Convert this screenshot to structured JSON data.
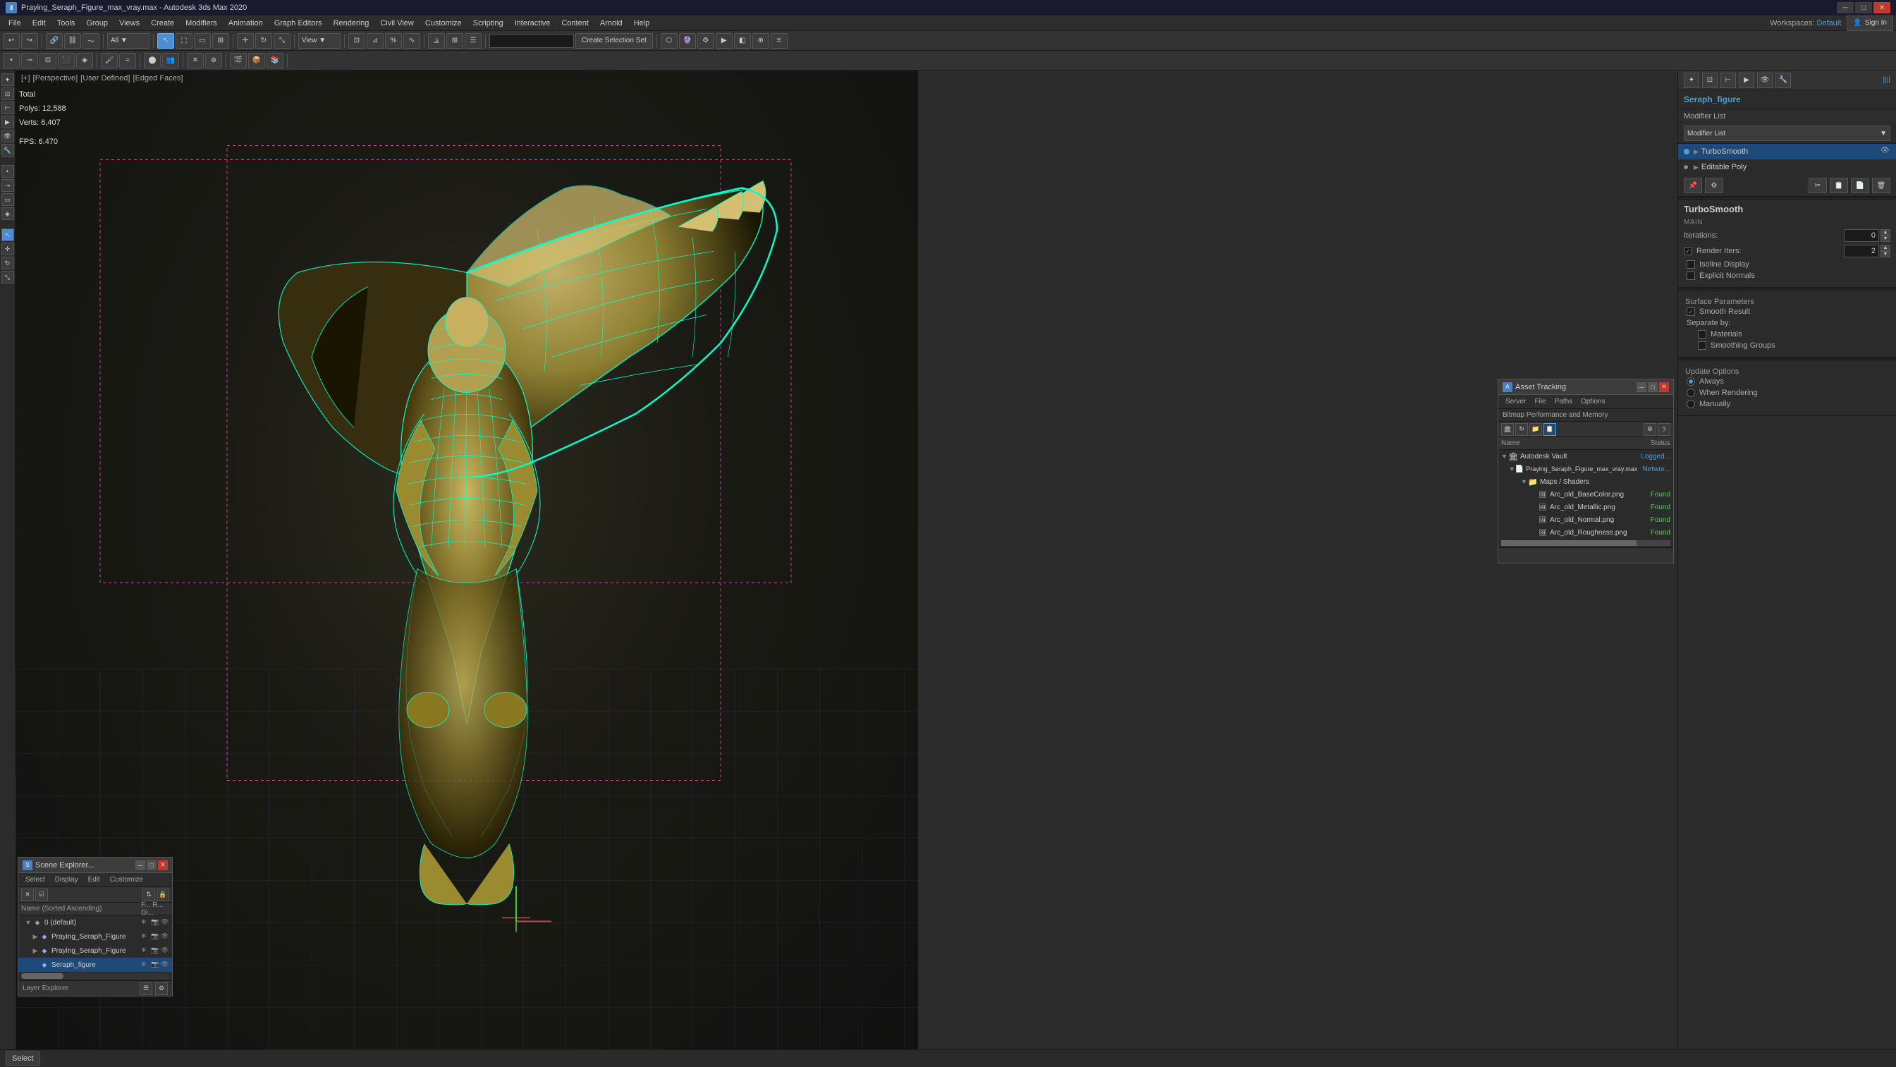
{
  "window": {
    "title": "Praying_Seraph_Figure_max_vray.max - Autodesk 3ds Max 2020",
    "icon": "3dsmax"
  },
  "menu": {
    "items": [
      "File",
      "Edit",
      "Tools",
      "Group",
      "Views",
      "Create",
      "Modifiers",
      "Animation",
      "Graph Editors",
      "Rendering",
      "Civil View",
      "Customize",
      "Scripting",
      "Interactive",
      "Content",
      "Arnold",
      "Help"
    ]
  },
  "workspaces": {
    "label": "Workspaces:",
    "value": "Default"
  },
  "signin": {
    "label": "Sign In",
    "icon": "user-icon"
  },
  "toolbar": {
    "create_selection_set": "Create Selection Set",
    "undo_icon": "↩",
    "redo_icon": "↪"
  },
  "viewport": {
    "label": "[+] [Perspective] [User Defined] [Edged Faces]",
    "nav_parts": [
      "[+]",
      "[Perspective]",
      "[User Defined]",
      "[Edged Faces]"
    ],
    "stats": {
      "total_label": "Total",
      "polys_label": "Polys:",
      "polys_value": "12,588",
      "verts_label": "Verts:",
      "verts_value": "6,407",
      "fps_label": "FPS:",
      "fps_value": "6.470"
    }
  },
  "right_panel": {
    "object_name": "Seraph_figure",
    "modifier_list_label": "Modifier List",
    "modifiers": [
      {
        "name": "TurboSmooth",
        "selected": true
      },
      {
        "name": "Editable Poly",
        "selected": false
      }
    ],
    "mod_buttons": [
      "pin",
      "configure",
      "remove",
      "cut"
    ],
    "turbosmooth": {
      "title": "TurboSmooth",
      "section_main": "Main",
      "iterations_label": "Iterations:",
      "iterations_value": "0",
      "render_iters_label": "Render Iters:",
      "render_iters_value": "2",
      "render_iters_checked": true,
      "isoline_display_label": "Isoline Display",
      "isoline_display_checked": false,
      "explicit_normals_label": "Explicit Normals",
      "explicit_normals_checked": false,
      "surface_parameters_label": "Surface Parameters",
      "smooth_result_label": "Smooth Result",
      "smooth_result_checked": true,
      "separate_by_label": "Separate by:",
      "materials_label": "Materials",
      "materials_checked": false,
      "smoothing_groups_label": "Smoothing Groups",
      "smoothing_groups_checked": false,
      "update_options_label": "Update Options",
      "always_label": "Always",
      "always_selected": true,
      "when_rendering_label": "When Rendering",
      "when_rendering_selected": false,
      "manually_label": "Manually",
      "manually_selected": false
    }
  },
  "scene_explorer": {
    "title": "Scene Explorer...",
    "menus": [
      "Select",
      "Display",
      "Edit",
      "Customize"
    ],
    "columns": {
      "name": "Name (Sorted Ascending)",
      "f_col": "F...",
      "r_col": "R...",
      "d_col": "Di..."
    },
    "items": [
      {
        "indent": 0,
        "expand": true,
        "type": "layer",
        "name": "0 (default)",
        "flags": [
          "freeze",
          "render",
          "display"
        ]
      },
      {
        "indent": 1,
        "expand": false,
        "type": "object",
        "name": "Praying_Seraph_Figure",
        "flags": [
          "freeze",
          "render",
          "display"
        ],
        "selected": false
      },
      {
        "indent": 1,
        "expand": false,
        "type": "object",
        "name": "Praying_Seraph_Figure",
        "flags": [
          "freeze",
          "render",
          "display"
        ],
        "selected": false
      },
      {
        "indent": 1,
        "expand": false,
        "type": "object",
        "name": "Seraph_figure",
        "flags": [
          "freeze",
          "render",
          "display"
        ],
        "selected": true
      }
    ],
    "bottom_label": "Layer Explorer"
  },
  "asset_tracking": {
    "title": "Asset Tracking",
    "menus": [
      "Server",
      "File",
      "Paths",
      "Options"
    ],
    "subtitle": "Bitmap Performance and Memory",
    "columns": {
      "name": "Name",
      "status": "Status"
    },
    "items": [
      {
        "indent": 0,
        "expand": true,
        "type": "vault",
        "name": "Autodesk Vault",
        "status": "Logged...",
        "status_type": "logged"
      },
      {
        "indent": 1,
        "expand": true,
        "type": "file",
        "name": "Praying_Seraph_Figure_max_vray.max",
        "status": "Networ...",
        "status_type": "network"
      },
      {
        "indent": 2,
        "expand": true,
        "type": "folder",
        "name": "Maps / Shaders",
        "status": "",
        "status_type": ""
      },
      {
        "indent": 3,
        "expand": false,
        "type": "bitmap",
        "name": "Arc_old_BaseColor.png",
        "status": "Found",
        "status_type": "found"
      },
      {
        "indent": 3,
        "expand": false,
        "type": "bitmap",
        "name": "Arc_old_Metallic.png",
        "status": "Found",
        "status_type": "found"
      },
      {
        "indent": 3,
        "expand": false,
        "type": "bitmap",
        "name": "Arc_old_Normal.png",
        "status": "Found",
        "status_type": "found"
      },
      {
        "indent": 3,
        "expand": false,
        "type": "bitmap",
        "name": "Arc_old_Roughness.png",
        "status": "Found",
        "status_type": "found"
      }
    ]
  },
  "statusbar": {
    "select_label": "Select",
    "status_text": ""
  },
  "icons": {
    "expand": "▶",
    "collapse": "▼",
    "eye": "👁",
    "freeze": "❄",
    "folder": "📁",
    "file": "📄",
    "bitmap": "🖼",
    "vault": "🏛",
    "layer": "◈",
    "object": "◆",
    "check": "✓",
    "dot": "●",
    "pin": "📌",
    "remove": "🗑",
    "link": "🔗",
    "up": "▲",
    "down": "▼",
    "left": "◀",
    "right": "▶",
    "close": "✕",
    "minimize": "─",
    "maximize": "□"
  }
}
